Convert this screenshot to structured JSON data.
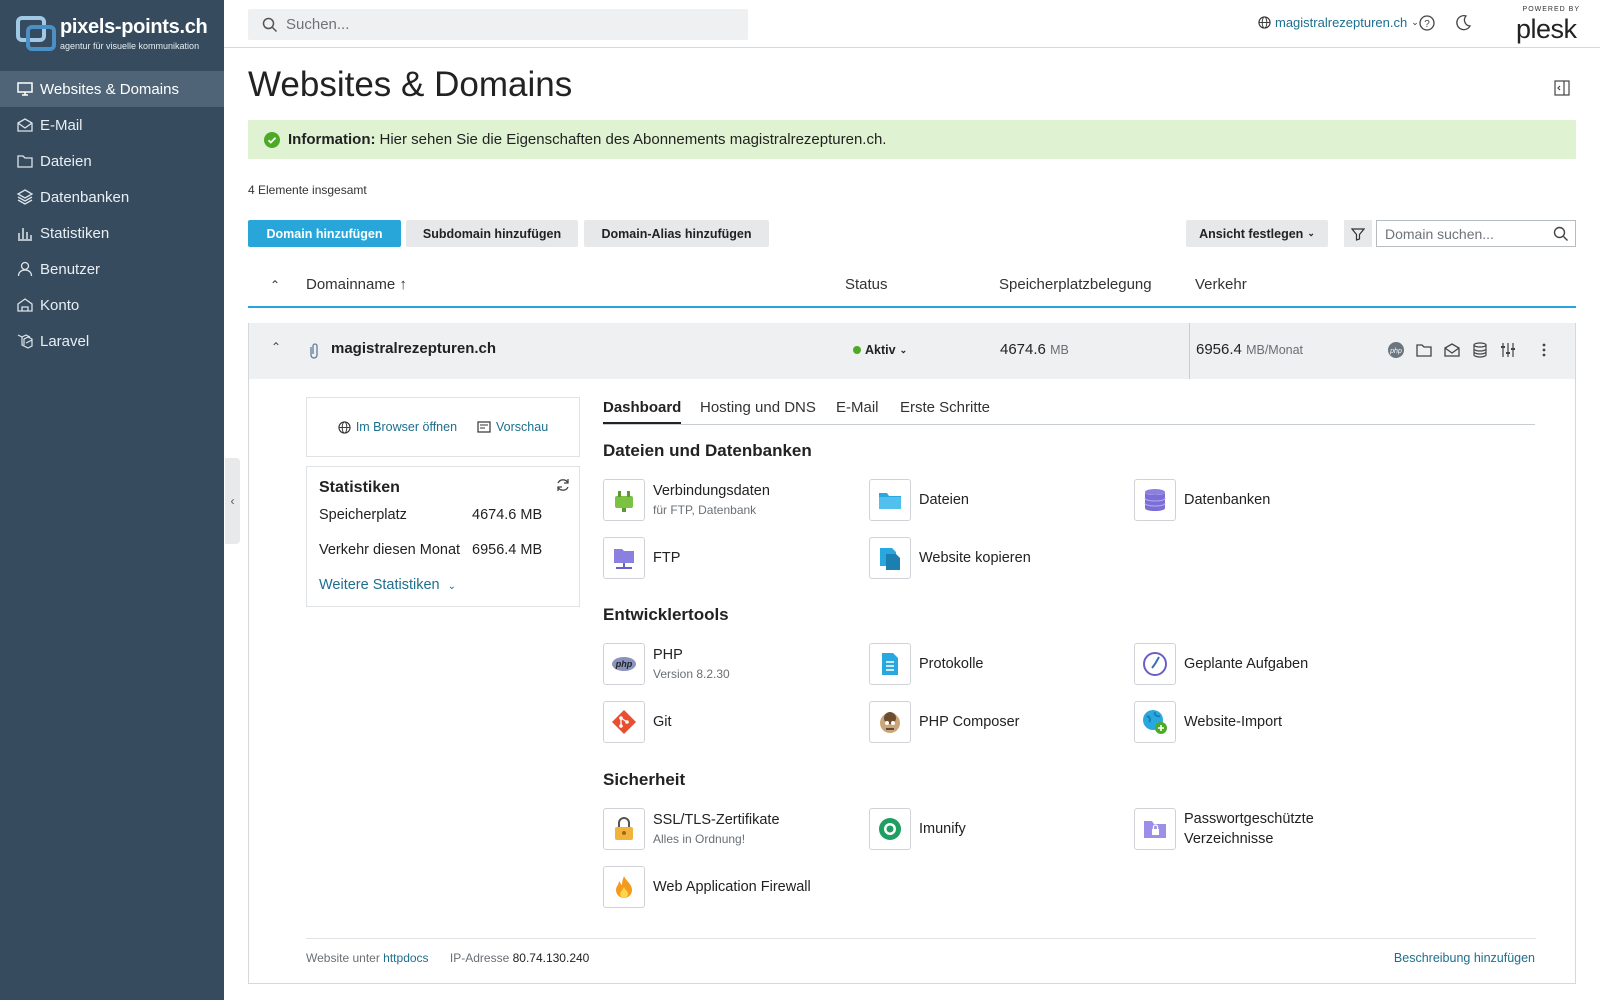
{
  "brand": {
    "title": "pixels-points.ch",
    "subtitle": "agentur für visuelle kommunikation"
  },
  "sidebar": {
    "items": [
      {
        "label": "Websites & Domains",
        "icon": "monitor-icon",
        "active": true
      },
      {
        "label": "E-Mail",
        "icon": "mail-icon"
      },
      {
        "label": "Dateien",
        "icon": "folder-icon"
      },
      {
        "label": "Datenbanken",
        "icon": "database-layers-icon"
      },
      {
        "label": "Statistiken",
        "icon": "bar-chart-icon"
      },
      {
        "label": "Benutzer",
        "icon": "user-icon"
      },
      {
        "label": "Konto",
        "icon": "account-icon"
      },
      {
        "label": "Laravel",
        "icon": "laravel-icon"
      }
    ]
  },
  "topbar": {
    "search_placeholder": "Suchen...",
    "domain": "magistralrezepturen.ch",
    "powered_by": "POWERED BY",
    "plesk": "plesk"
  },
  "page": {
    "title": "Websites & Domains",
    "info_label": "Information:",
    "info_text": "Hier sehen Sie die Eigenschaften des Abonnements magistralrezepturen.ch.",
    "count": "4 Elemente insgesamt"
  },
  "toolbar": {
    "add_domain": "Domain hinzufügen",
    "add_subdomain": "Subdomain hinzufügen",
    "add_alias": "Domain-Alias hinzufügen",
    "view": "Ansicht festlegen",
    "domain_search_placeholder": "Domain suchen..."
  },
  "table": {
    "headers": {
      "name": "Domainname ↑",
      "status": "Status",
      "disk": "Speicherplatzbelegung",
      "traffic": "Verkehr"
    },
    "row": {
      "domain": "magistralrezepturen.ch",
      "status": "Aktiv",
      "disk_value": "4674.6",
      "disk_unit": "MB",
      "traffic_value": "6956.4",
      "traffic_unit": "MB/Monat"
    }
  },
  "panel": {
    "open_browser": "Im Browser öffnen",
    "preview": "Vorschau",
    "stats": {
      "title": "Statistiken",
      "disk_label": "Speicherplatz",
      "disk_value": "4674.6 MB",
      "traffic_label": "Verkehr diesen Monat",
      "traffic_value": "6956.4 MB",
      "more": "Weitere Statistiken"
    },
    "tabs": [
      "Dashboard",
      "Hosting und DNS",
      "E-Mail",
      "Erste Schritte"
    ],
    "sections": {
      "files": "Dateien und Datenbanken",
      "dev": "Entwicklertools",
      "security": "Sicherheit"
    },
    "tools": {
      "connection": {
        "name": "Verbindungsdaten",
        "sub": "für FTP, Datenbank"
      },
      "files": {
        "name": "Dateien"
      },
      "databases": {
        "name": "Datenbanken"
      },
      "ftp": {
        "name": "FTP"
      },
      "copy": {
        "name": "Website kopieren"
      },
      "php": {
        "name": "PHP",
        "sub": "Version 8.2.30"
      },
      "logs": {
        "name": "Protokolle"
      },
      "cron": {
        "name": "Geplante Aufgaben"
      },
      "git": {
        "name": "Git"
      },
      "composer": {
        "name": "PHP Composer"
      },
      "import": {
        "name": "Website-Import"
      },
      "ssl": {
        "name": "SSL/TLS-Zertifikate",
        "sub": "Alles in Ordnung!"
      },
      "imunify": {
        "name": "Imunify"
      },
      "protected": {
        "name": "Passwortgeschützte Verzeichnisse"
      },
      "waf": {
        "name": "Web Application Firewall"
      }
    },
    "footer": {
      "website_label": "Website unter",
      "website_dir": "httpdocs",
      "ip_label": "IP-Adresse",
      "ip_value": "80.74.130.240",
      "add_description": "Beschreibung hinzufügen"
    }
  },
  "colors": {
    "sidebar": "#364b5e",
    "primary": "#28a6d9",
    "info_bg": "#dff3d2",
    "link": "#1d6f8e",
    "active_dot": "#4caa27"
  }
}
